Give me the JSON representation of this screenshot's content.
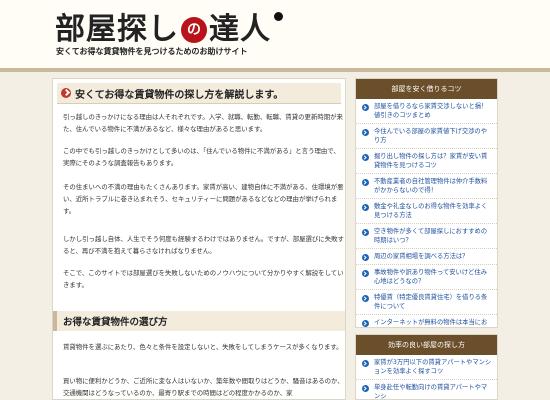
{
  "header": {
    "logo_text_1": "部屋探し",
    "logo_mark": "の",
    "logo_text_2": "達人",
    "tagline": "安くてお得な賃貸物件を見つけるためのお助けサイト"
  },
  "article": {
    "title": "安くてお得な賃貸物件の探し方を解説します。",
    "paragraphs": [
      "引っ越しのきっかけになる理由は人それぞれです。入学、就職、転勤、転職、賃貸の更新時期が来た、住んでいる物件に不満があるなど、様々な理由があると思います。",
      "この中でも引っ越しのきっかけとして多いのは、「住んでいる物件に不満がある」と言う理由で、実際にそのような調査報告もあります。",
      "その住まいへの不満の理由もたくさんあります。家賃が高い、建物自体に不満がある、住環境が悪い、近所トラブルに巻き込まれそう、セキュリティーに問題があるなどなどの理由が挙げられます。",
      "しかし引っ越し自体、人生でそう何度も経験するわけではありません。ですが、部屋選びに失敗すると、再び不満を抱えて暮らさなければなりません。",
      "そこで、このサイトでは部屋選びを失敗しないためのノウハウについて分かりやすく解説をしていきます。"
    ],
    "section_title": "お得な賃貸物件の選び方",
    "section_paragraphs": [
      "賃貸物件を選ぶにあたり、色々と条件を設定しないと、失敗をしてしまうケースが多くなります。",
      "買い物に便利かどうか、ご近所に変な人はいないか、築年数や間取りはどうか、騒音はあるのか、交通機関はどうなっているのか、最寄り駅までの時間はどの程度かかるのか、家"
    ]
  },
  "sidebar": {
    "block1": {
      "heading": "部屋を安く借りるコツ",
      "items": [
        "部屋を借りるなら家賃交渉しないと損！値引きのコツまとめ",
        "今住んでいる部屋の家賃値下げ交渉のやり方",
        "掘り出し物件の探し方は？家賃が安い賃貸物件を見つけるコツ",
        "不動産業者の自社管理物件は仲介手数料がかからないので得！",
        "敷金や礼金なしのお得な物件を効率よく見つける方法",
        "空き物件が多くて部屋探しにおすすめの時期はいつ？",
        "周辺の家賃相場を調べる方法は？",
        "事故物件や訳あり物件って安いけど住み心地はどうなの？",
        "特優賃（特定優良賃貸住宅）を借りる条件について",
        "インターネットが無料の物件は本当にお得な物件なの？"
      ]
    },
    "block2": {
      "heading": "効率の良い部屋の探し方",
      "items": [
        "家賃が3万円以下の賃貸アパートやマンションを効率よく探すコツ",
        "単身赴任や転勤向けの賃貸アパートやマンシ"
      ]
    }
  }
}
